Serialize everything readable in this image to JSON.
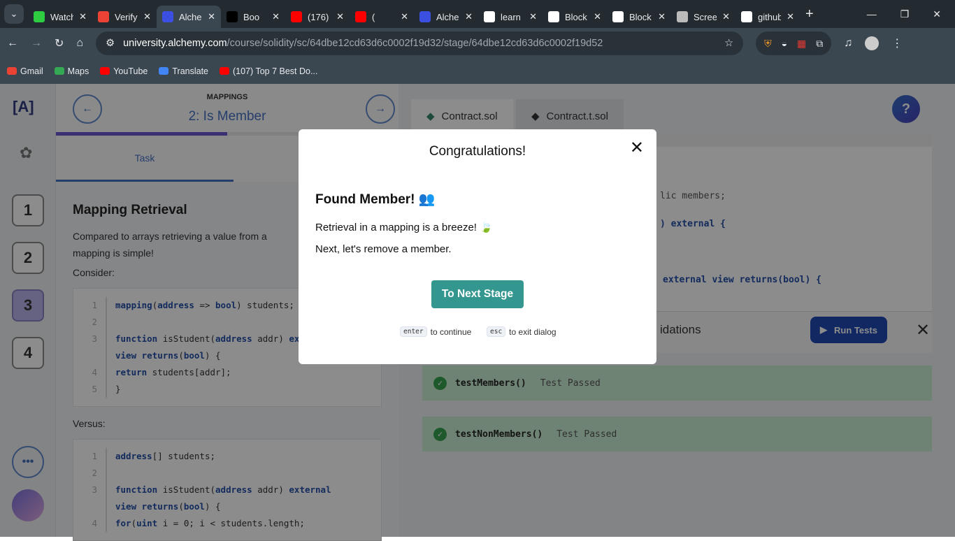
{
  "browser": {
    "tabs": [
      {
        "title": "Watch",
        "fav": "#2ecc40"
      },
      {
        "title": "Verify",
        "fav": "#ea4335"
      },
      {
        "title": "Alchemy",
        "fav": "#3b4fe0",
        "active": true
      },
      {
        "title": "Boo",
        "fav": "#000"
      },
      {
        "title": "(176)",
        "fav": "#ff0000"
      },
      {
        "title": "(",
        "fav": "#ff0000"
      },
      {
        "title": "Alchemy",
        "fav": "#3b4fe0"
      },
      {
        "title": "learn",
        "fav": "#fff"
      },
      {
        "title": "Block",
        "fav": "#fff"
      },
      {
        "title": "Block",
        "fav": "#fff"
      },
      {
        "title": "Screen",
        "fav": "#bbb"
      },
      {
        "title": "github",
        "fav": "#fff"
      }
    ],
    "url_domain": "university.alchemy.com",
    "url_path": "/course/solidity/sc/64dbe12cd63d6c0002f19d32/stage/64dbe12cd63d6c0002f19d52",
    "bookmarks": [
      {
        "label": "Gmail",
        "color": "#ea4335"
      },
      {
        "label": "Maps",
        "color": "#34a853"
      },
      {
        "label": "YouTube",
        "color": "#ff0000"
      },
      {
        "label": "Translate",
        "color": "#4285f4"
      },
      {
        "label": "(107) Top 7 Best Do...",
        "color": "#ff0000"
      }
    ]
  },
  "sidebar": {
    "logo": "[A]",
    "steps": [
      "1",
      "2",
      "3",
      "4"
    ],
    "current_step": "3",
    "more": "•••"
  },
  "stage": {
    "course": "MAPPINGS",
    "title": "2: Is Member",
    "progress_percent": 50,
    "tab": "Task"
  },
  "task": {
    "heading": "Mapping Retrieval",
    "intro": "Compared to arrays retrieving a value from a mapping is simple!",
    "consider": "Consider:",
    "versus": "Versus:",
    "code1": [
      [
        "1",
        "mapping(address => bool) students;"
      ],
      [
        "2",
        ""
      ],
      [
        "3",
        "function isStudent(address addr) external"
      ],
      [
        "",
        "view returns(bool) {"
      ],
      [
        "4",
        "    return students[addr];"
      ],
      [
        "5",
        "}"
      ]
    ],
    "code2": [
      [
        "1",
        "address[] students;"
      ],
      [
        "2",
        ""
      ],
      [
        "3",
        "function isStudent(address addr) external"
      ],
      [
        "",
        "view returns(bool) {"
      ],
      [
        "4",
        "    for(uint i = 0; i < students.length;"
      ]
    ]
  },
  "editor": {
    "files": [
      "Contract.sol",
      "Contract.t.sol"
    ],
    "lines": [
      "lic members;",
      ") external {",
      "external view returns(bool) {"
    ],
    "validations_label": "idations",
    "run_tests": "Run Tests",
    "tests": [
      {
        "name": "testMembers()",
        "status": "Test Passed"
      },
      {
        "name": "testNonMembers()",
        "status": "Test Passed"
      }
    ]
  },
  "modal": {
    "title": "Congratulations!",
    "heading": "Found Member! 👥",
    "line1": "Retrieval in a mapping is a breeze! 🍃",
    "line2": "Next, let's remove a member.",
    "button": "To Next Stage",
    "hint_enter_key": "enter",
    "hint_enter": "to continue",
    "hint_esc_key": "esc",
    "hint_esc": "to exit dialog"
  }
}
